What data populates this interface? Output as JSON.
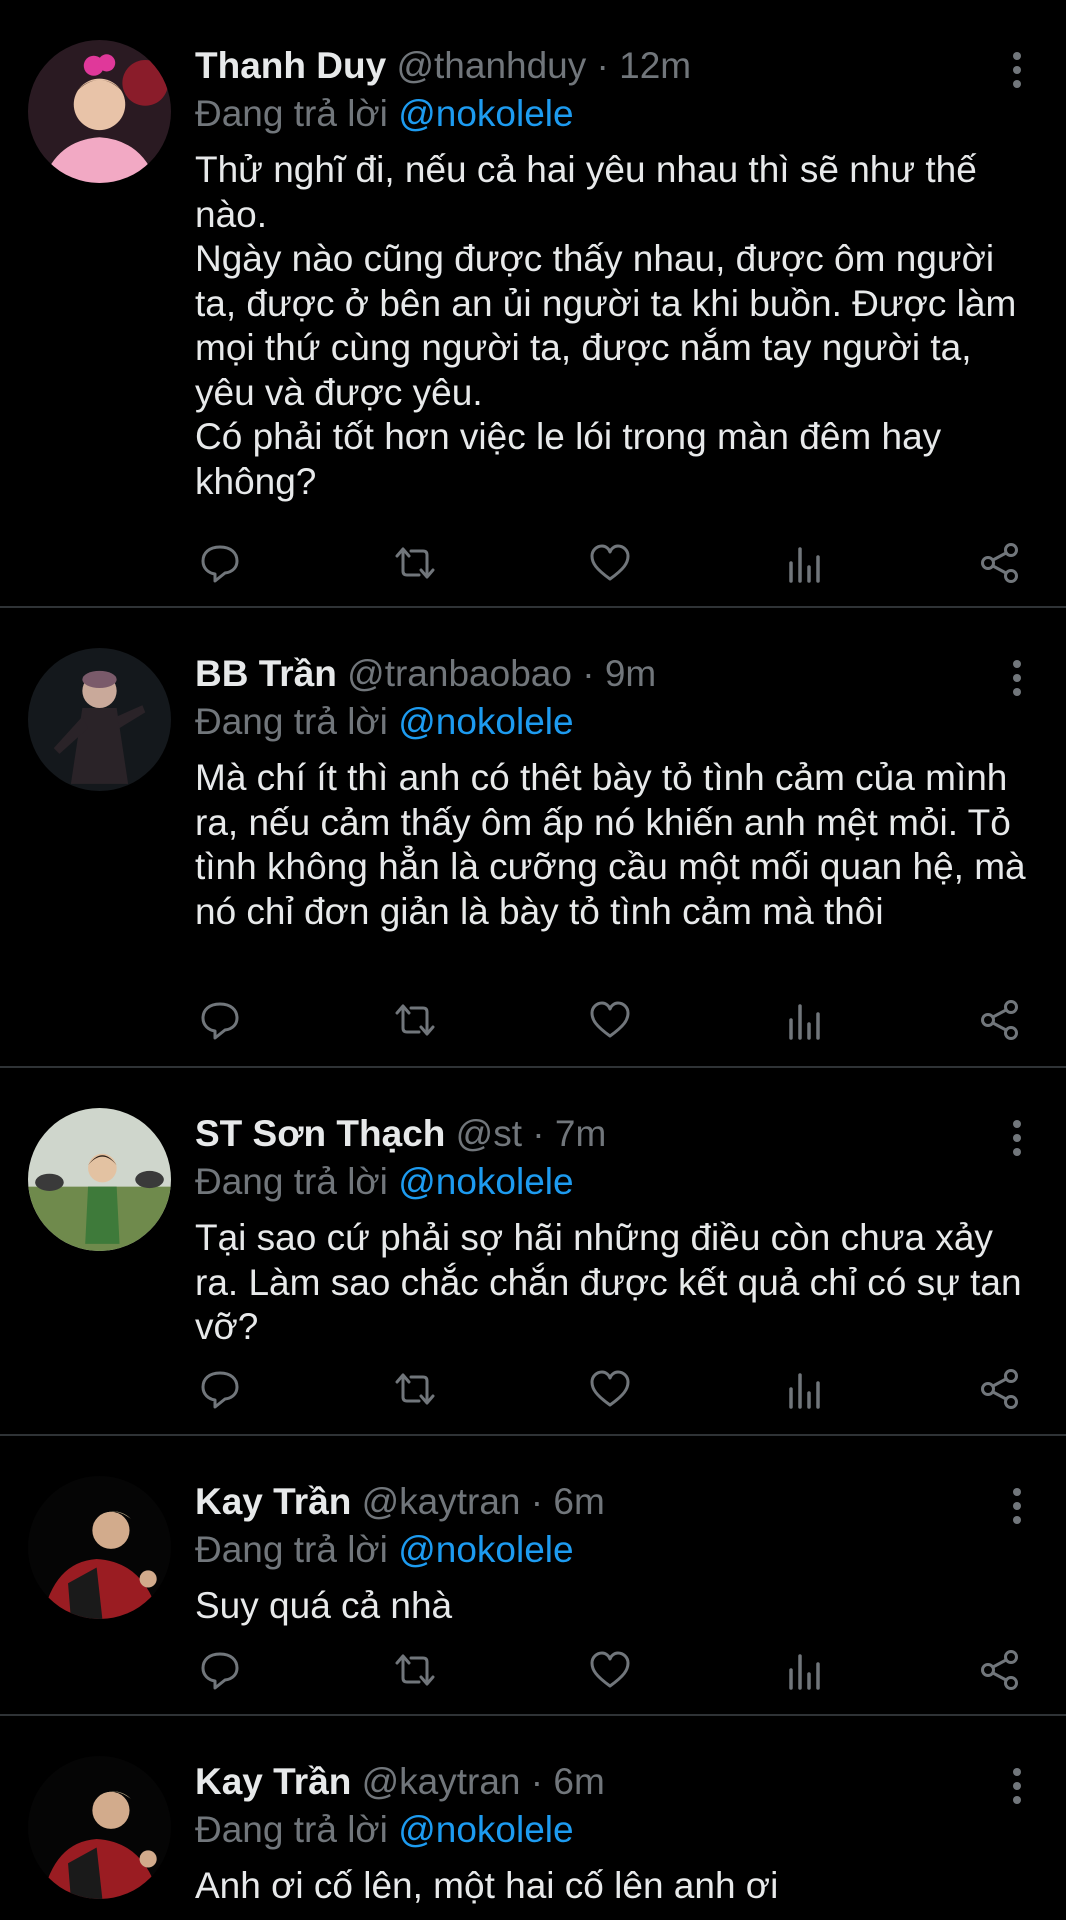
{
  "colors": {
    "background": "#000000",
    "divider": "#2f3336",
    "primary_text": "#e7e9ea",
    "secondary_text": "#71767b",
    "mention": "#1d9bf0"
  },
  "action_icons": [
    "reply-icon",
    "retweet-icon",
    "like-icon",
    "analytics-icon",
    "share-icon"
  ],
  "tweets": [
    {
      "name": "Thanh Duy",
      "handle": "@thanhduy",
      "separator": "·",
      "time": "12m",
      "replying_prefix": "Đang trả lời",
      "replying_to": "@nokolele",
      "text": "Thử nghĩ đi, nếu cả hai yêu nhau thì sẽ như thế nào.\nNgày nào cũng được thấy nhau, được ôm người ta, được ở bên an ủi người ta khi buồn. Được làm mọi thứ cùng người ta, được nắm tay người ta, yêu và được yêu.\nCó phải tốt hơn việc le lói trong màn đêm hay không?"
    },
    {
      "name": "BB Trần",
      "handle": "@tranbaobao",
      "separator": "·",
      "time": "9m",
      "replying_prefix": "Đang trả lời",
      "replying_to": "@nokolele",
      "text": "Mà chí ít thì anh có thêt bày tỏ tình cảm của mình ra, nếu cảm thấy ôm ấp nó khiến anh mệt mỏi. Tỏ tình không hẳn là cưỡng cầu một mối quan hệ, mà nó chỉ đơn giản là bày tỏ tình cảm mà thôi"
    },
    {
      "name": "ST Sơn Thạch",
      "handle": "@st",
      "separator": "·",
      "time": "7m",
      "replying_prefix": "Đang trả lời",
      "replying_to": "@nokolele",
      "text": "Tại sao cứ phải sợ hãi những điều còn chưa xảy ra. Làm sao chắc chắn được kết quả chỉ có sự tan vỡ?"
    },
    {
      "name": "Kay Trần",
      "handle": "@kaytran",
      "separator": "·",
      "time": "6m",
      "replying_prefix": "Đang trả lời",
      "replying_to": "@nokolele",
      "text": "Suy quá cả nhà"
    },
    {
      "name": "Kay Trần",
      "handle": "@kaytran",
      "separator": "·",
      "time": "6m",
      "replying_prefix": "Đang trả lời",
      "replying_to": "@nokolele",
      "text": "Anh ơi cố lên, một hai cố lên anh ơi"
    }
  ]
}
